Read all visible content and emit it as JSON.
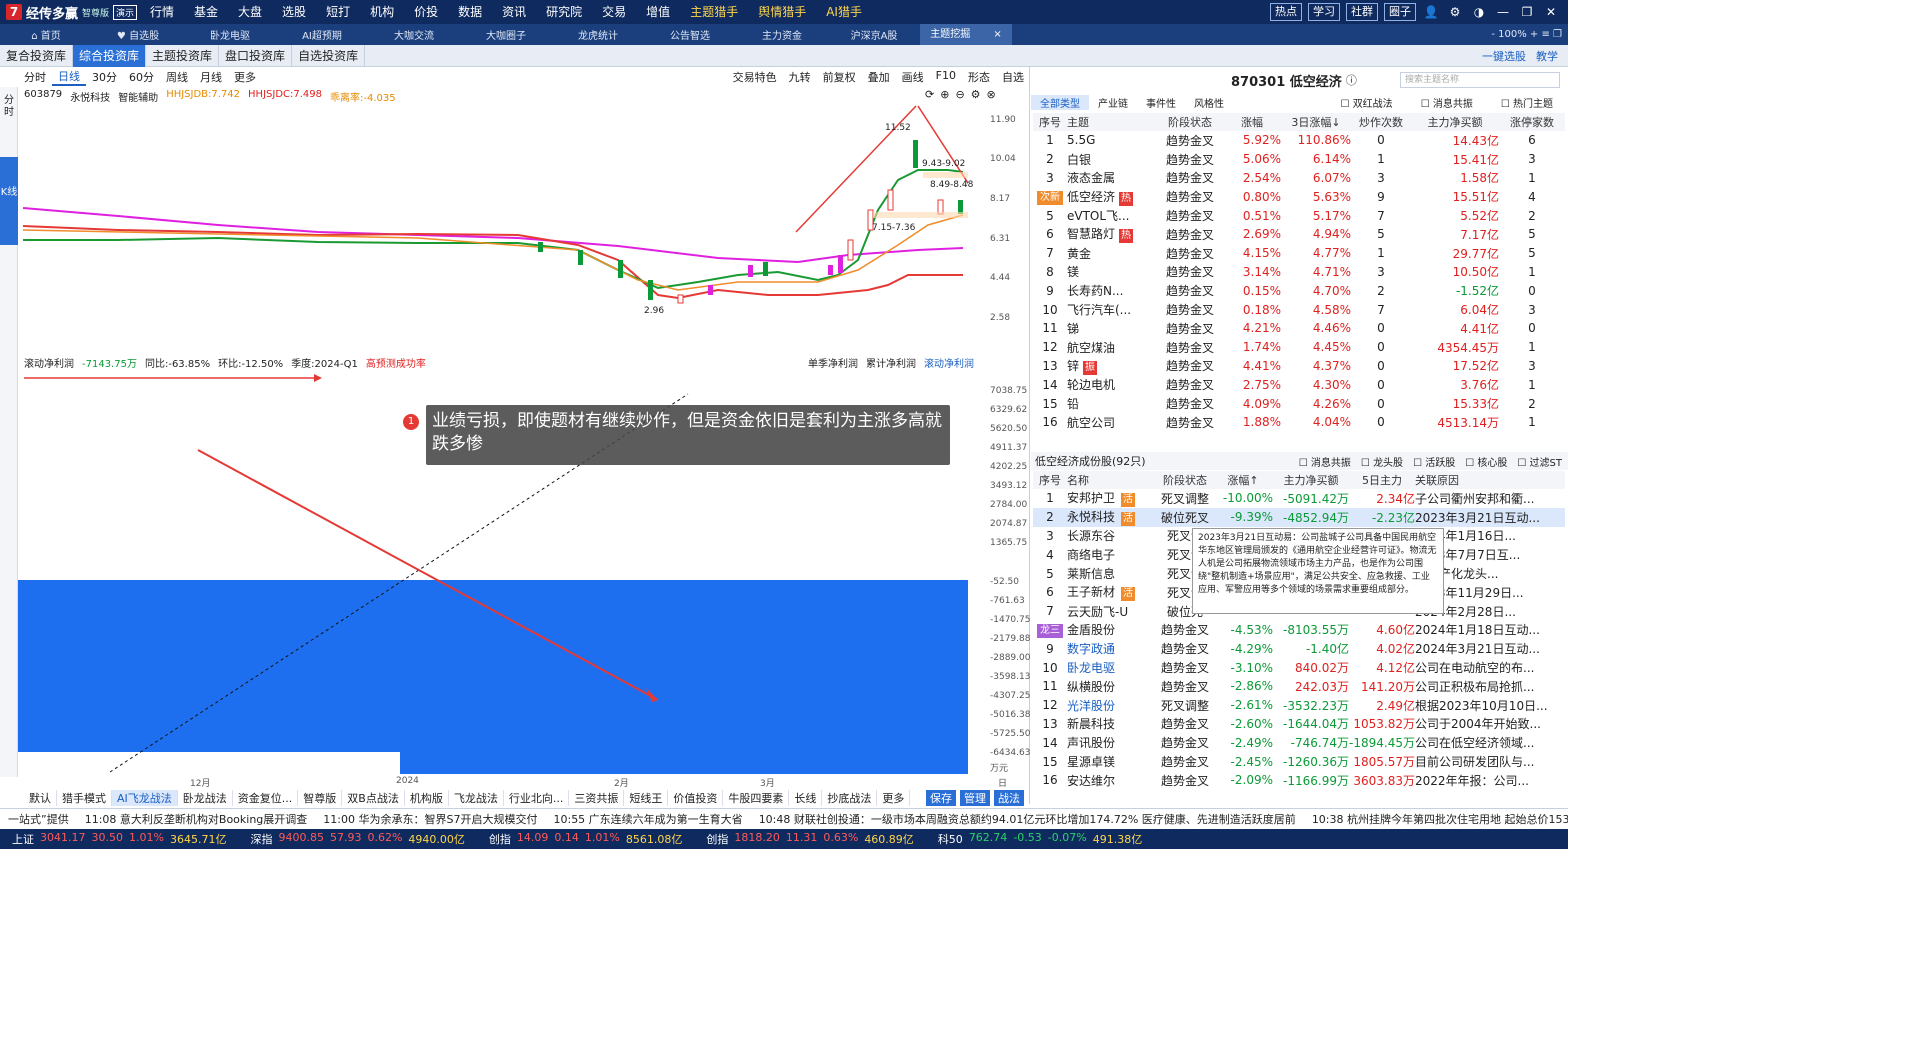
{
  "app": {
    "name": "经传多赢",
    "edition": "智尊版",
    "badge": "演示"
  },
  "top_menu": [
    "行情",
    "基金",
    "大盘",
    "选股",
    "短打",
    "机构",
    "价投",
    "数据",
    "资讯",
    "研究院",
    "交易",
    "增值",
    "主题猎手",
    "舆情猎手",
    "AI猎手"
  ],
  "top_right": {
    "b1": "热点",
    "b2": "学习",
    "b3": "社群",
    "b4": "圈子"
  },
  "tabs": [
    "首页",
    "自选股",
    "卧龙电驱",
    "AI超预期",
    "大咖交流",
    "大咖圈子",
    "龙虎统计",
    "公告智选",
    "主力资金",
    "沪深京A股",
    "主题挖掘"
  ],
  "sub_tabs": [
    "复合投资库",
    "综合投资库",
    "主题投资库",
    "盘口投资库",
    "自选投资库"
  ],
  "sub_right": {
    "a": "一键选股",
    "b": "教学"
  },
  "chart_toolbar": {
    "period": "分时",
    "items": [
      "日线",
      "30分",
      "60分",
      "周线",
      "月线",
      "更多"
    ],
    "right": [
      "交易特色",
      "九转",
      "前复权",
      "叠加",
      "画线",
      "F10",
      "形态",
      "自选"
    ]
  },
  "left_strip": {
    "a": "分时",
    "b": "K线"
  },
  "stock": {
    "code": "603879",
    "name": "永悦科技",
    "assist": "智能辅助",
    "ind1": "HHJSJDB:7.742",
    "ind2": "HHJSJDC:7.498",
    "ind3": "乖离率:-4.035"
  },
  "price_axis": [
    "11.90",
    "10.04",
    "8.17",
    "6.31",
    "4.44",
    "2.58"
  ],
  "price_labels": {
    "high": "11.52",
    "a": "9.43-9.02",
    "b": "8.49-8.48",
    "c": "7.15-7.36",
    "low": "2.96"
  },
  "lower": {
    "a": "滚动净利润",
    "b": "-7143.75万",
    "c": "同比:-63.85%",
    "d": "环比:-12.50%",
    "e": "季度:2024-Q1",
    "f": "高预测成功率",
    "r1": "单季净利润",
    "r2": "累计净利润",
    "r3": "滚动净利润"
  },
  "lower_axis": [
    "7038.75",
    "6329.62",
    "5620.50",
    "4911.37",
    "4202.25",
    "3493.12",
    "2784.00",
    "2074.87",
    "1365.75",
    "-52.50",
    "-761.63",
    "-1470.75",
    "-2179.88",
    "-2889.00",
    "-3598.13",
    "-4307.25",
    "-5016.38",
    "-5725.50",
    "-6434.63"
  ],
  "unit": "万元",
  "x_axis": [
    "12月",
    "2024",
    "2月",
    "3月"
  ],
  "daily": "日线",
  "annotation": {
    "num": "1",
    "text": "业绩亏损，即使题材有继续炒作，但是资金依旧是套利为主涨多高就跌多惨"
  },
  "bottom_tools": [
    "默认",
    "猎手模式",
    "AI飞龙战法",
    "卧龙战法",
    "资金复位...",
    "智尊版",
    "双B点战法",
    "机构版",
    "飞龙战法",
    "行业北向...",
    "三资共振",
    "短线王",
    "价值投资",
    "牛股四要素",
    "长线",
    "抄底战法",
    "更多"
  ],
  "bottom_right": [
    "保存",
    "管理",
    "战法"
  ],
  "theme": {
    "title": "870301 低空经济",
    "search": "搜索主题名称",
    "tabs": [
      "全部类型",
      "产业链",
      "事件性",
      "风格性"
    ],
    "opts": [
      "双红战法",
      "消息共振",
      "热门主题"
    ]
  },
  "theme_headers": [
    "序号",
    "主题",
    "阶段状态",
    "涨幅",
    "3日涨幅↓",
    "炒作次数",
    "主力净买额",
    "涨停家数"
  ],
  "theme_rows": [
    [
      "1",
      "5.5G",
      "",
      "趋势金叉",
      "5.92%",
      "110.86%",
      "0",
      "14.43亿",
      "6"
    ],
    [
      "2",
      "白银",
      "",
      "趋势金叉",
      "5.06%",
      "6.14%",
      "1",
      "15.41亿",
      "3"
    ],
    [
      "3",
      "液态金属",
      "",
      "趋势金叉",
      "2.54%",
      "6.07%",
      "3",
      "1.58亿",
      "1"
    ],
    [
      "次新",
      "低空经济",
      "热",
      "趋势金叉",
      "0.80%",
      "5.63%",
      "9",
      "15.51亿",
      "4"
    ],
    [
      "5",
      "eVTOL飞...",
      "",
      "趋势金叉",
      "0.51%",
      "5.17%",
      "7",
      "5.52亿",
      "2"
    ],
    [
      "6",
      "智慧路灯",
      "热",
      "趋势金叉",
      "2.69%",
      "4.94%",
      "5",
      "7.17亿",
      "5"
    ],
    [
      "7",
      "黄金",
      "",
      "趋势金叉",
      "4.15%",
      "4.77%",
      "1",
      "29.77亿",
      "5"
    ],
    [
      "8",
      "镁",
      "",
      "趋势金叉",
      "3.14%",
      "4.71%",
      "3",
      "10.50亿",
      "1"
    ],
    [
      "9",
      "长寿药N...",
      "",
      "趋势金叉",
      "0.15%",
      "4.70%",
      "2",
      "-1.52亿",
      "0"
    ],
    [
      "10",
      "飞行汽车(...",
      "",
      "趋势金叉",
      "0.18%",
      "4.58%",
      "7",
      "6.04亿",
      "3"
    ],
    [
      "11",
      "锑",
      "",
      "趋势金叉",
      "4.21%",
      "4.46%",
      "0",
      "4.41亿",
      "0"
    ],
    [
      "12",
      "航空煤油",
      "",
      "趋势金叉",
      "1.74%",
      "4.45%",
      "0",
      "4354.45万",
      "1"
    ],
    [
      "13",
      "锌",
      "振",
      "趋势金叉",
      "4.41%",
      "4.37%",
      "0",
      "17.52亿",
      "3"
    ],
    [
      "14",
      "轮边电机",
      "",
      "趋势金叉",
      "2.75%",
      "4.30%",
      "0",
      "3.76亿",
      "1"
    ],
    [
      "15",
      "铅",
      "",
      "趋势金叉",
      "4.09%",
      "4.26%",
      "0",
      "15.33亿",
      "2"
    ],
    [
      "16",
      "航空公司",
      "",
      "趋势金叉",
      "1.88%",
      "4.04%",
      "0",
      "4513.14万",
      "1"
    ]
  ],
  "stocks_title": "低空经济成份股(92只)",
  "stocks_opts": [
    "消息共振",
    "龙头股",
    "活跃股",
    "核心股",
    "过滤ST"
  ],
  "stock_headers": [
    "序号",
    "名称",
    "阶段状态",
    "涨幅↑",
    "主力净买额",
    "5日主力",
    "关联原因"
  ],
  "stock_rows": [
    [
      "1",
      "安邦护卫",
      "活",
      "死叉调整",
      "-10.00%",
      "-5091.42万",
      "2.34亿",
      "子公司衢州安邦和衢..."
    ],
    [
      "2",
      "永悦科技",
      "活",
      "破位死叉",
      "-9.39%",
      "-4852.94万",
      "-2.23亿",
      "2023年3月21日互动..."
    ],
    [
      "3",
      "长源东谷",
      "",
      "死叉调",
      "",
      "",
      "",
      "2024年1月16日..."
    ],
    [
      "4",
      "商络电子",
      "",
      "死叉调",
      "",
      "",
      "",
      "2023年7月7日互..."
    ],
    [
      "5",
      "莱斯信息",
      "",
      "死叉调",
      "",
      "",
      "",
      "管国产化龙头..."
    ],
    [
      "6",
      "王子新材",
      "活",
      "死叉调",
      "",
      "",
      "",
      "2023年11月29日..."
    ],
    [
      "7",
      "云天励飞-U",
      "",
      "破位死",
      "",
      "",
      "",
      "2024年2月28日..."
    ],
    [
      "龙三",
      "金盾股份",
      "",
      "趋势金叉",
      "-4.53%",
      "-8103.55万",
      "4.60亿",
      "2024年1月18日互动..."
    ],
    [
      "9",
      "数字政通",
      "",
      "趋势金叉",
      "-4.29%",
      "-1.40亿",
      "4.02亿",
      "2024年3月21日互动..."
    ],
    [
      "10",
      "卧龙电驱",
      "",
      "趋势金叉",
      "-3.10%",
      "840.02万",
      "4.12亿",
      "公司在电动航空的布..."
    ],
    [
      "11",
      "纵横股份",
      "",
      "趋势金叉",
      "-2.86%",
      "242.03万",
      "141.20万",
      "公司正积极布局抢抓..."
    ],
    [
      "12",
      "光洋股份",
      "",
      "死叉调整",
      "-2.61%",
      "-3532.23万",
      "2.49亿",
      "根据2023年10月10日..."
    ],
    [
      "13",
      "新晨科技",
      "",
      "趋势金叉",
      "-2.60%",
      "-1644.04万",
      "1053.82万",
      "公司于2004年开始致..."
    ],
    [
      "14",
      "声讯股份",
      "",
      "趋势金叉",
      "-2.49%",
      "-746.74万",
      "-1894.45万",
      "公司在低空经济领域..."
    ],
    [
      "15",
      "星源卓镁",
      "",
      "趋势金叉",
      "-2.45%",
      "-1260.36万",
      "1805.57万",
      "目前公司研发团队与..."
    ],
    [
      "16",
      "安达维尔",
      "",
      "趋势金叉",
      "-2.09%",
      "-1166.99万",
      "3603.83万",
      "2022年年报：公司..."
    ]
  ],
  "tooltip": "2023年3月21日互动易：公司盐城子公司具备中国民用航空华东地区管理局颁发的《通用航空企业经营许可证》。物流无人机是公司拓展物流领域市场主力产品，也是作为公司围绕\"整机制造+场景应用\"，满足公共安全、应急救援、工业应用、军警应用等多个领域的场景需求重要组成部分。",
  "news": [
    "一站式”提供",
    "11:08 意大利反垄断机构对Booking展开调查",
    "11:00 华为余承东：智界S7开启大规模交付",
    "10:55 广东连续六年成为第一生育大省",
    "10:48 财联社创投通：一级市场本周融资总额约94.01亿元环比增加174.72% 医疗健康、先进制造活跃度居前",
    "10:38 杭州挂牌今年第四批次住宅用地 起始总价153."
  ],
  "indices": [
    {
      "name": "上证",
      "v": "3041.17",
      "c": "30.50",
      "p": "1.01%",
      "a": "3645.71亿",
      "dir": "up"
    },
    {
      "name": "深指",
      "v": "9400.85",
      "c": "57.93",
      "p": "0.62%",
      "a": "4940.00亿",
      "dir": "up"
    },
    {
      "name": "创指",
      "v": "14.09",
      "c": "0.14",
      "p": "1.01%",
      "a": "8561.08亿",
      "dir": "up"
    },
    {
      "name": "创指",
      "v": "1818.20",
      "c": "11.31",
      "p": "0.63%",
      "a": "460.89亿",
      "dir": "up"
    },
    {
      "name": "科50",
      "v": "762.74",
      "c": "-0.53",
      "p": "-0.07%",
      "a": "491.38亿",
      "dir": "down"
    }
  ],
  "colors": {
    "blue": "#1e6ff0",
    "up": "#e0201f",
    "down": "#0b9a37",
    "nav": "#0f2a5e"
  }
}
